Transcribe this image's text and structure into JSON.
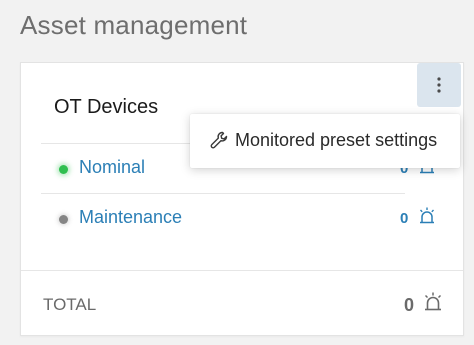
{
  "page": {
    "title": "Asset management"
  },
  "card": {
    "title": "OT Devices",
    "menu_icon": "vertical-ellipsis-icon",
    "rows": [
      {
        "label": "Nominal",
        "count": "0",
        "status_color": "#2fbf4f",
        "icon": "alarm-icon"
      },
      {
        "label": "Maintenance",
        "count": "0",
        "status_color": "#858585",
        "icon": "alarm-icon"
      }
    ],
    "total": {
      "label": "TOTAL",
      "count": "0",
      "icon": "alarm-icon"
    }
  },
  "dropdown": {
    "items": [
      {
        "label": "Monitored preset settings",
        "icon": "wrench-icon"
      }
    ]
  },
  "colors": {
    "link": "#2b7fb6",
    "menu_button_bg": "#dbe5ee",
    "muted_text": "#6a6a6a"
  }
}
